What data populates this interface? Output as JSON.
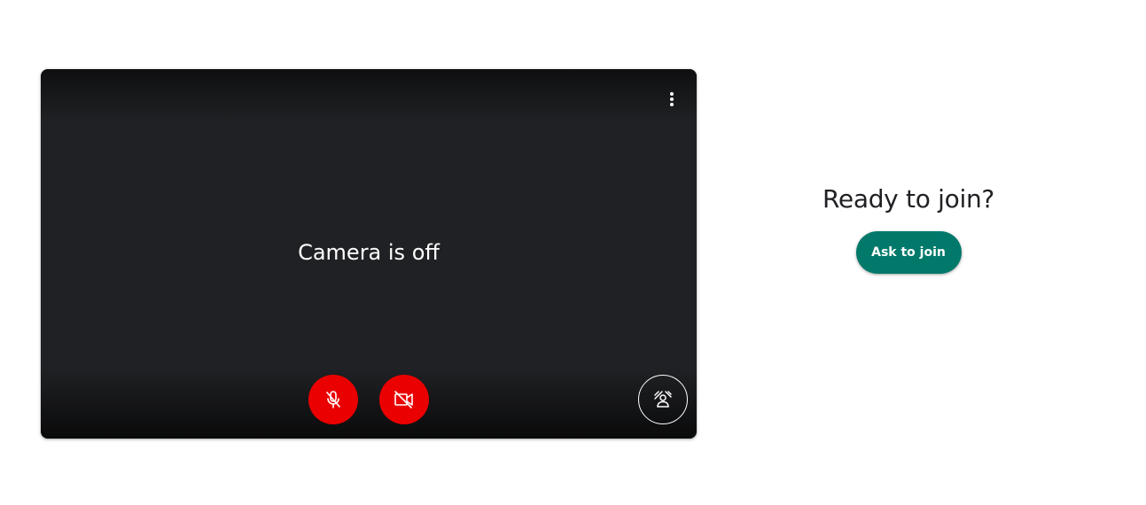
{
  "preview": {
    "status_text": "Camera is off",
    "more_options_icon": "more-vert-icon",
    "controls": {
      "microphone": {
        "icon": "mic-off-icon",
        "state": "off",
        "color": "#ea0000"
      },
      "camera": {
        "icon": "videocam-off-icon",
        "state": "off",
        "color": "#ea0000"
      },
      "effects": {
        "icon": "visual-effects-icon"
      }
    }
  },
  "join": {
    "title": "Ready to join?",
    "button_label": "Ask to join",
    "button_color": "#00796b"
  }
}
